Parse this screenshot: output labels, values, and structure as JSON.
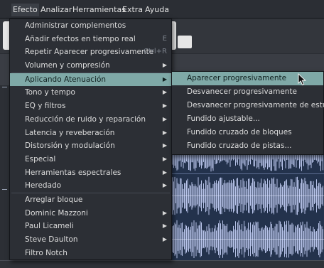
{
  "menubar": {
    "items": [
      {
        "label": "Efecto",
        "active": true
      },
      {
        "label": "Analizar"
      },
      {
        "label": "Herramientas"
      },
      {
        "label": "Extra"
      },
      {
        "label": "Ayuda"
      }
    ]
  },
  "effect_menu": {
    "items": [
      {
        "label": "Administrar complementos"
      },
      {
        "label": "Añadir efectos en tiempo real",
        "shortcut": "E"
      },
      {
        "label": "Repetir Aparecer progresivamente",
        "shortcut": "Ctrl+R"
      },
      {
        "label": "Volumen y compresión",
        "submenu": true
      },
      {
        "label": "Aplicando Atenuación",
        "submenu": true,
        "highlighted": true
      },
      {
        "label": "Tono y tempo",
        "submenu": true
      },
      {
        "label": "EQ y filtros",
        "submenu": true
      },
      {
        "label": "Reducción de ruido y reparación",
        "submenu": true
      },
      {
        "label": "Latencia y reveberación",
        "submenu": true
      },
      {
        "label": "Distorsión y modulación",
        "submenu": true
      },
      {
        "label": "Especial",
        "submenu": true
      },
      {
        "label": "Herramientas espectrales",
        "submenu": true
      },
      {
        "label": "Heredado",
        "submenu": true
      },
      {
        "label": "Arreglar bloque"
      },
      {
        "label": "Dominic Mazzoni",
        "submenu": true
      },
      {
        "label": "Paul Licameli",
        "submenu": true
      },
      {
        "label": "Steve Daulton",
        "submenu": true
      },
      {
        "label": "Filtro Notch"
      }
    ],
    "arrow_glyph": "▶"
  },
  "fade_submenu": {
    "items": [
      {
        "label": "Aparecer progresivamente",
        "highlighted": true
      },
      {
        "label": "Desvanecer progresivamente"
      },
      {
        "label": "Desvanecer progresivamente de estudio"
      },
      {
        "label": "Fundido ajustable..."
      },
      {
        "label": "Fundido cruzado de bloques"
      },
      {
        "label": "Fundido cruzado de pistas..."
      }
    ]
  },
  "colors": {
    "highlight": "#7fa9a7",
    "waveform": "#b8c4ea",
    "track_bg": "#23324c"
  }
}
